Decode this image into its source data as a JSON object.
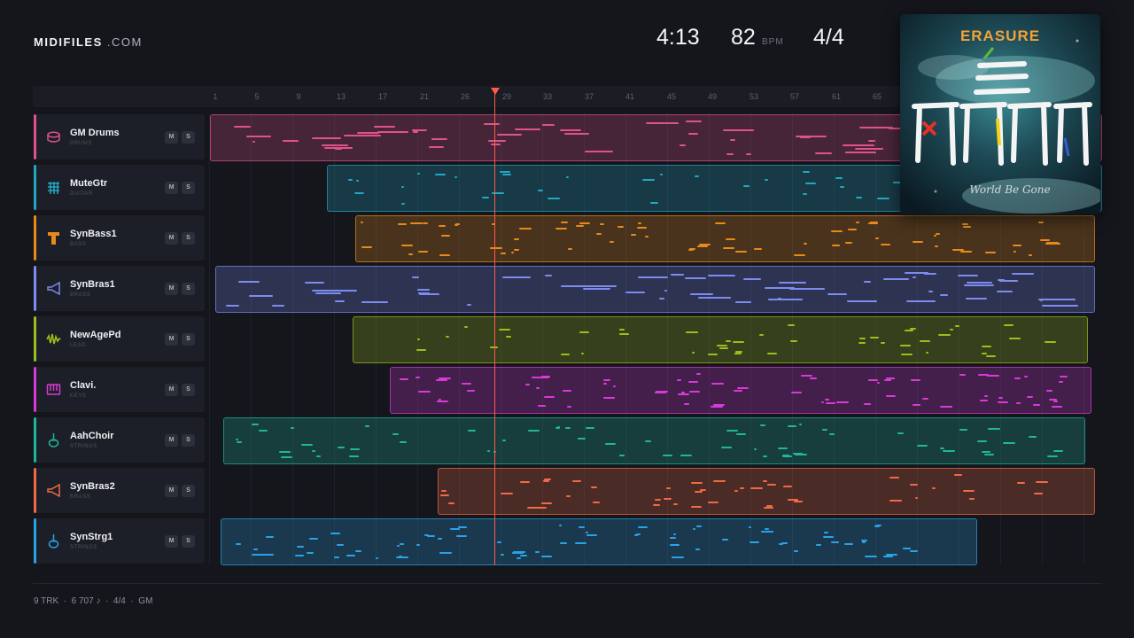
{
  "header": {
    "logo_bold": "MIDIFILES",
    "logo_light": " .COM",
    "duration": "4:13",
    "bpm_value": "82",
    "bpm_unit": "BPM",
    "time_signature": "4/4"
  },
  "album": {
    "artist": "ERASURE",
    "cover_script": "World Be Gone"
  },
  "ruler": {
    "ticks": [
      "1",
      "5",
      "9",
      "13",
      "17",
      "21",
      "26",
      "29",
      "33",
      "37",
      "41",
      "45",
      "49",
      "53",
      "57",
      "61",
      "65"
    ]
  },
  "tracks": [
    {
      "name": "GM Drums",
      "category": "DRUMS",
      "color": "#e0528a",
      "icon": "drum-icon",
      "mute": "M",
      "solo": "S"
    },
    {
      "name": "MuteGtr",
      "category": "GUITAR",
      "color": "#22a7c4",
      "icon": "guitar-grid-icon",
      "mute": "M",
      "solo": "S"
    },
    {
      "name": "SynBass1",
      "category": "BASS",
      "color": "#e88a1a",
      "icon": "bass-amp-icon",
      "mute": "M",
      "solo": "S"
    },
    {
      "name": "SynBras1",
      "category": "BRASS",
      "color": "#7c8cf0",
      "icon": "brass-horn-icon",
      "mute": "M",
      "solo": "S"
    },
    {
      "name": "NewAgePd",
      "category": "LEAD",
      "color": "#9bbf1c",
      "icon": "wave-icon",
      "mute": "M",
      "solo": "S"
    },
    {
      "name": "Clavi.",
      "category": "KEYS",
      "color": "#d83ad8",
      "icon": "keys-icon",
      "mute": "M",
      "solo": "S"
    },
    {
      "name": "AahChoir",
      "category": "STRINGS",
      "color": "#20b69a",
      "icon": "violin-icon",
      "mute": "M",
      "solo": "S"
    },
    {
      "name": "SynBras2",
      "category": "BRASS",
      "color": "#f06a45",
      "icon": "brass-horn-icon",
      "mute": "M",
      "solo": "S"
    },
    {
      "name": "SynStrg1",
      "category": "STRINGS",
      "color": "#2aa2e8",
      "icon": "violin-icon",
      "mute": "M",
      "solo": "S"
    }
  ],
  "footer": {
    "tracks": "9 TRK",
    "sep1": "·",
    "notes": "6 707 ♪",
    "sep2": "·",
    "meter": "4/4",
    "sep3": "·",
    "standard": "GM"
  }
}
